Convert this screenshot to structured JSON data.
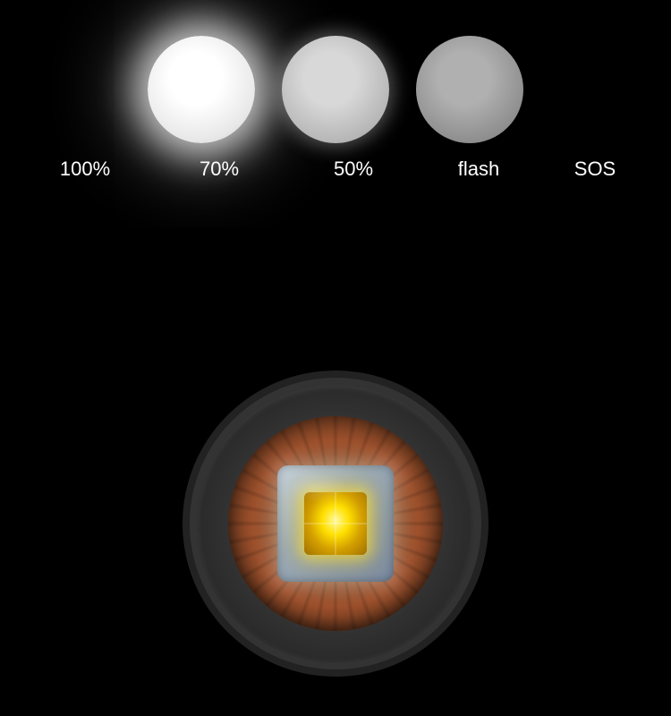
{
  "page": {
    "bg_color": "#000000"
  },
  "modes": {
    "circles": [
      {
        "id": "mode-100",
        "label": "100%",
        "brightness": "full"
      },
      {
        "id": "mode-70",
        "label": "70%",
        "brightness": "medium"
      },
      {
        "id": "mode-50",
        "label": "50%",
        "brightness": "low"
      }
    ],
    "extra_modes": [
      {
        "id": "mode-flash",
        "label": "flash"
      },
      {
        "id": "mode-sos",
        "label": "SOS"
      }
    ]
  },
  "lens": {
    "aria_label": "Flashlight LED lens front view"
  }
}
